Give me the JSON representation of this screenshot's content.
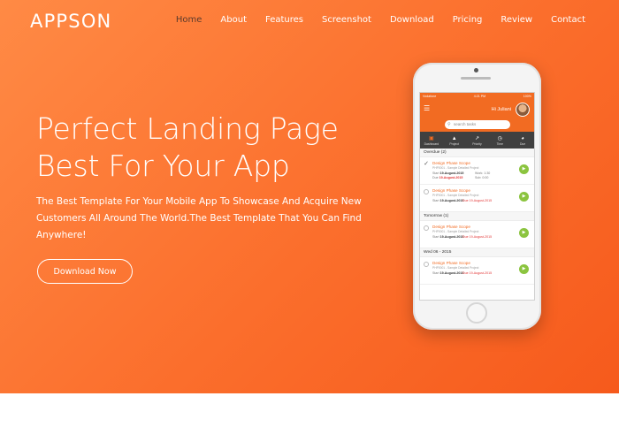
{
  "brand": {
    "logo": "APPSON"
  },
  "nav": {
    "items": [
      "Home",
      "About",
      "Features",
      "Screenshot",
      "Download",
      "Pricing",
      "Review",
      "Contact"
    ],
    "active": "Home"
  },
  "hero": {
    "headline_line1": "Perfect Landing Page",
    "headline_line2": "Best For Your App",
    "subtext": "The Best Template For Your Mobile App To Showcase And Acquire New Customers All Around The World.The Best Template That You Can Find Anywhere!",
    "cta_label": "Download Now"
  },
  "phone_app": {
    "status_left": "Vodafone",
    "status_time": "4:21 PM",
    "status_right": "100%",
    "greeting": "Hi Juliani",
    "search_placeholder": "search tasks",
    "tabs": [
      "Dashboard",
      "Project",
      "Priority",
      "Time",
      "Due"
    ],
    "sections": [
      {
        "heading": "Overdue (2)"
      },
      {
        "heading": "Tomorrow (1)"
      },
      {
        "heading": "Wed 06 - 2015"
      }
    ],
    "tasks": [
      {
        "title": "Design Phase Scope",
        "subtitle": "PHP0001 - Sample Detailed Project",
        "start_label": "Start",
        "start": "19-August-2015",
        "end_label": "Due",
        "end": "19-August-2015",
        "meta1": "Work: 1:30",
        "meta2": "Sub: 0:00",
        "done": true
      },
      {
        "title": "Design Phase Scope",
        "subtitle": "PHP0001 - Sample Detailed Project",
        "start_label": "Start",
        "start": "19-August-2015",
        "end_label": "Due",
        "end": "19-August-2015",
        "meta1": "",
        "meta2": "Due 19-August-2015",
        "done": false
      },
      {
        "title": "Design Phase Scope",
        "subtitle": "PHP0001 - Sample Detailed Project",
        "start_label": "Start",
        "start": "19-August-2015",
        "end_label": "Due",
        "end": "19-August-2015",
        "meta1": "",
        "meta2": "Due 19-August-2015",
        "done": false
      },
      {
        "title": "Design Phase Scope",
        "subtitle": "PHP0001 - Sample Detailed Project",
        "start_label": "Start",
        "start": "19-August-2015",
        "end_label": "Due",
        "end": "19-August-2015",
        "meta1": "",
        "meta2": "Due 19-August-2015",
        "done": false
      }
    ]
  },
  "colors": {
    "brand_orange": "#f26b22",
    "play_green": "#8bc43f"
  }
}
